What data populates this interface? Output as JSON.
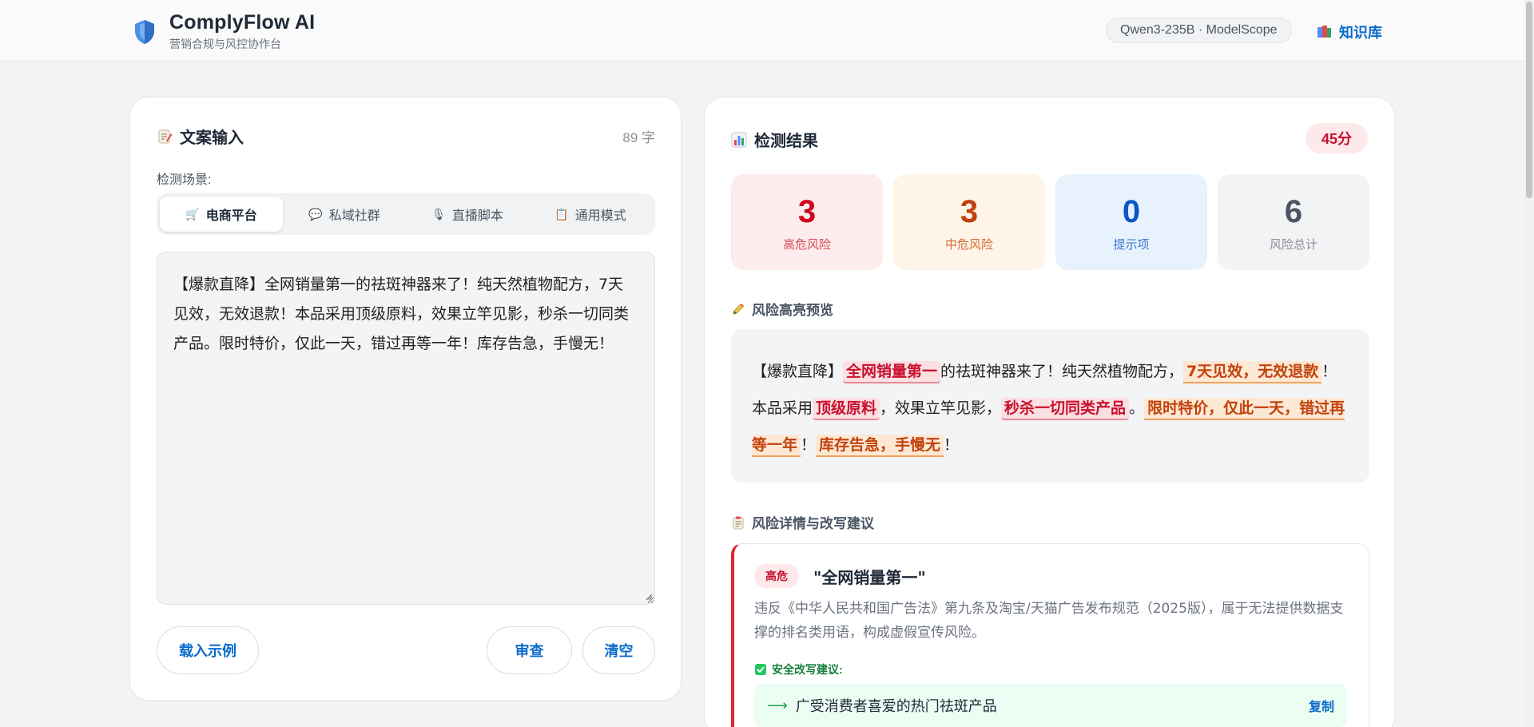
{
  "header": {
    "app_title": "ComplyFlow AI",
    "app_subtitle": "营销合规与风控协作台",
    "model_pill": "Qwen3-235B · ModelScope",
    "kb_link": "知识库"
  },
  "input_panel": {
    "title": "文案输入",
    "word_count": "89 字",
    "scene_label": "检测场景:",
    "tabs": [
      {
        "label": "电商平台",
        "icon": "cart-icon",
        "active": true
      },
      {
        "label": "私域社群",
        "icon": "speech-bubble-icon",
        "active": false
      },
      {
        "label": "直播脚本",
        "icon": "microphone-icon",
        "active": false
      },
      {
        "label": "通用模式",
        "icon": "clipboard-icon",
        "active": false
      }
    ],
    "copy_text": "【爆款直降】全网销量第一的祛斑神器来了！纯天然植物配方，7天见效，无效退款！本品采用顶级原料，效果立竿见影，秒杀一切同类产品。限时特价，仅此一天，错过再等一年！库存告急，手慢无！",
    "buttons": {
      "load_example": "载入示例",
      "review": "审查",
      "clear": "清空"
    }
  },
  "result_panel": {
    "title": "检测结果",
    "score": "45分",
    "stats": [
      {
        "value": "3",
        "label": "高危风险",
        "kind": "high"
      },
      {
        "value": "3",
        "label": "中危风险",
        "kind": "mid"
      },
      {
        "value": "0",
        "label": "提示项",
        "kind": "tip"
      },
      {
        "value": "6",
        "label": "风险总计",
        "kind": "total"
      }
    ],
    "preview_title": "风险高亮预览",
    "preview_segments": [
      {
        "text": "【爆款直降】",
        "level": "none"
      },
      {
        "text": "全网销量第一",
        "level": "high"
      },
      {
        "text": "的祛斑神器来了！纯天然植物配方，",
        "level": "none"
      },
      {
        "text": "7天见效，无效退款",
        "level": "mid"
      },
      {
        "text": "！本品采用",
        "level": "none"
      },
      {
        "text": "顶级原料",
        "level": "high"
      },
      {
        "text": "，效果立竿见影，",
        "level": "none"
      },
      {
        "text": "秒杀一切同类产品",
        "level": "high"
      },
      {
        "text": "。",
        "level": "none"
      },
      {
        "text": "限时特价，仅此一天，错过再等一年",
        "level": "mid"
      },
      {
        "text": "！",
        "level": "none"
      },
      {
        "text": "库存告急，手慢无",
        "level": "mid"
      },
      {
        "text": "！",
        "level": "none"
      }
    ],
    "details_title": "风险详情与改写建议",
    "risk_item": {
      "level_tag": "高危",
      "term": "\"全网销量第一\"",
      "description": "违反《中华人民共和国广告法》第九条及淘宝/天猫广告发布规范（2025版），属于无法提供数据支撑的排名类用语，构成虚假宣传风险。",
      "suggest_label": "安全改写建议:",
      "suggestion": "广受消费者喜爱的热门祛斑产品",
      "copy_label": "复制"
    }
  },
  "colors": {
    "brand_blue": "#0b6bcb",
    "high_risk": "#d0021b",
    "mid_risk": "#c2410c",
    "tip": "#0b57c9",
    "safe_green": "#15803d"
  }
}
